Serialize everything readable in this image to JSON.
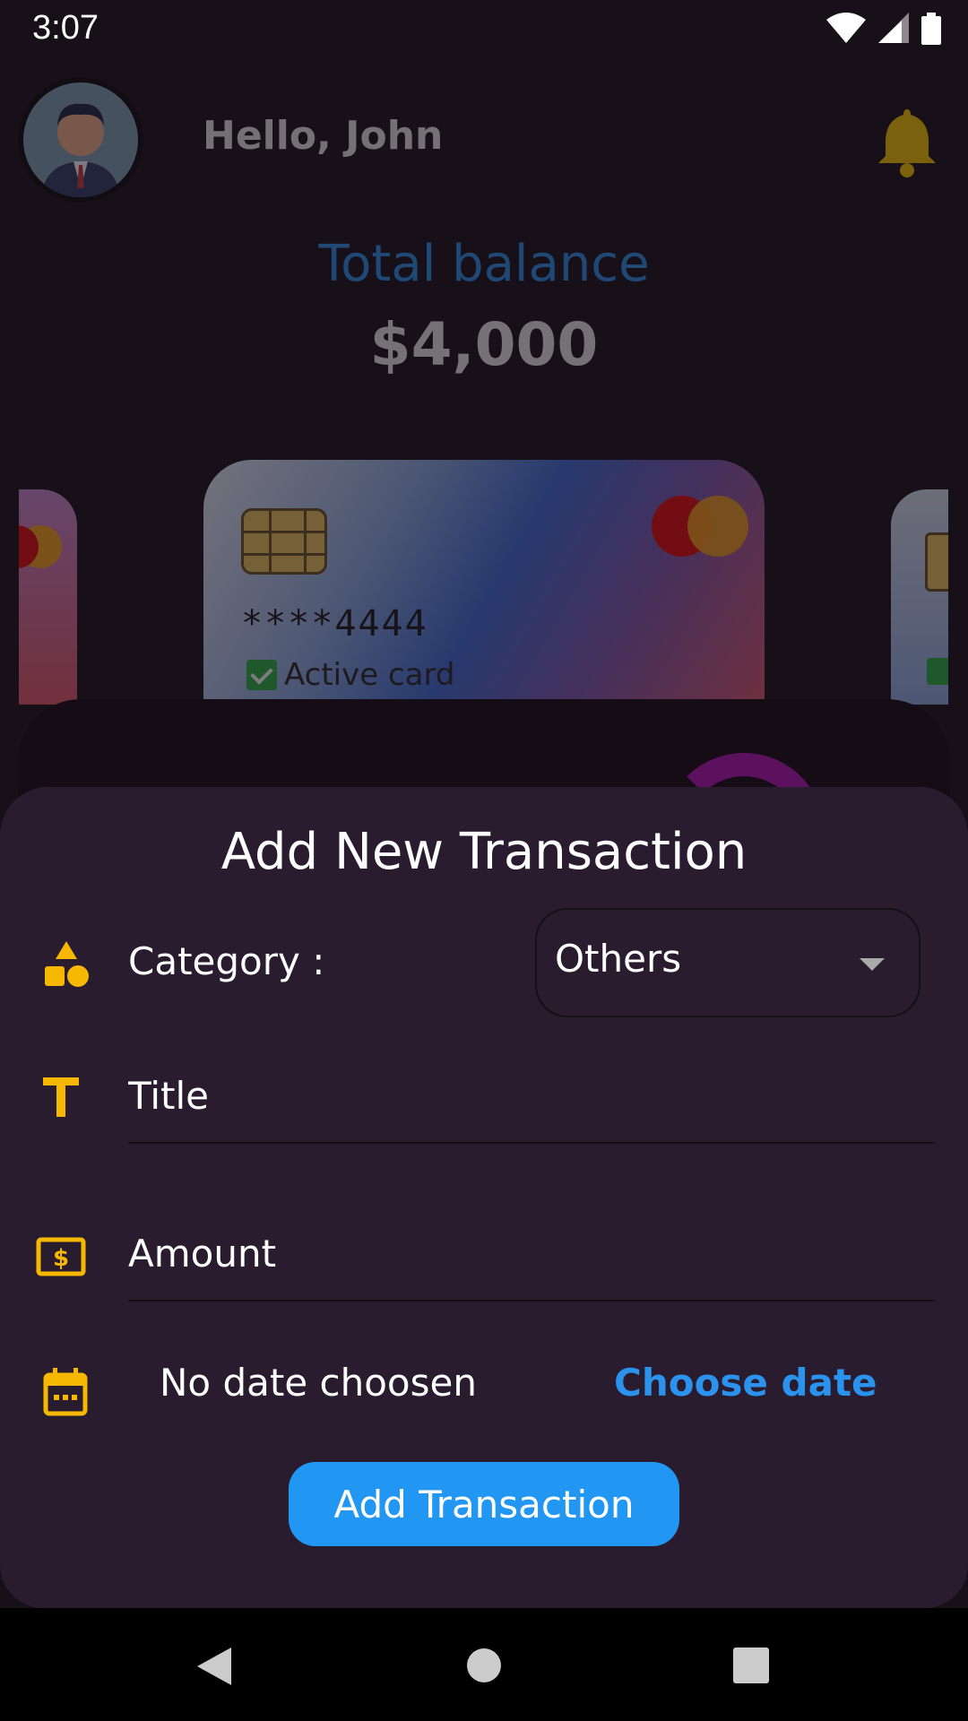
{
  "status_bar": {
    "time": "3:07"
  },
  "header": {
    "greeting": "Hello, John"
  },
  "balance": {
    "label": "Total balance",
    "value": "$4,000"
  },
  "card": {
    "number": "****4444",
    "status": "Active card"
  },
  "sheet": {
    "title": "Add New Transaction",
    "category_label": "Category :",
    "category_value": "Others",
    "title_placeholder": "Title",
    "amount_placeholder": "Amount",
    "date_text": "No date choosen",
    "choose_date_label": "Choose date",
    "submit_label": "Add Transaction"
  },
  "colors": {
    "accent_blue": "#2196f3",
    "icon_yellow": "#f5b700",
    "sheet_bg": "#2a1c2f",
    "app_bg": "#181019"
  },
  "icons": {
    "status": [
      "wifi-icon",
      "signal-icon",
      "battery-icon"
    ],
    "header": [
      "avatar",
      "bell-icon"
    ],
    "form": [
      "category-shapes-icon",
      "title-t-icon",
      "amount-dollar-icon",
      "calendar-icon"
    ],
    "nav": [
      "back-icon",
      "home-icon",
      "recents-icon"
    ]
  }
}
